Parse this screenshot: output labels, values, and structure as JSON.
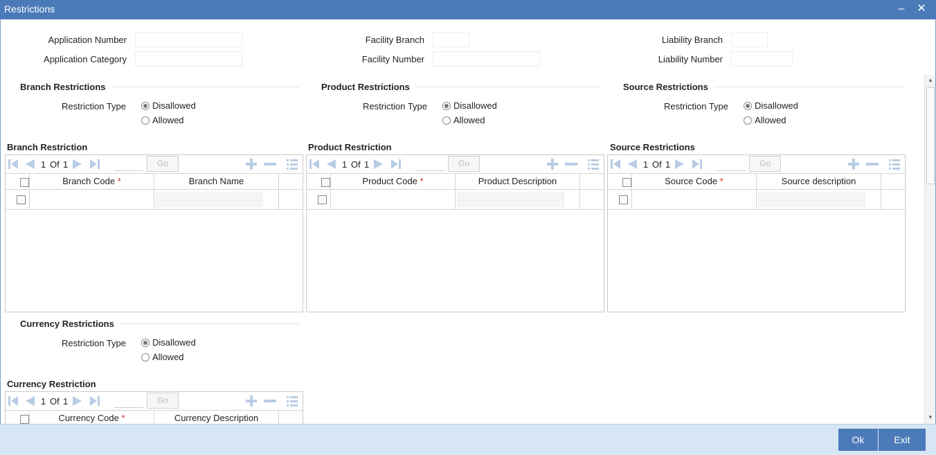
{
  "window": {
    "title": "Restrictions",
    "minimize": "‒",
    "close": "✕"
  },
  "header_fields": {
    "application_number": {
      "label": "Application Number",
      "value": ""
    },
    "application_category": {
      "label": "Application Category",
      "value": ""
    },
    "facility_branch": {
      "label": "Facility Branch",
      "value": ""
    },
    "facility_number": {
      "label": "Facility Number",
      "value": ""
    },
    "liability_branch": {
      "label": "Liability Branch",
      "value": ""
    },
    "liability_number": {
      "label": "Liability Number",
      "value": ""
    }
  },
  "restriction_label": "Restriction Type",
  "options": {
    "disallowed": "Disallowed",
    "allowed": "Allowed"
  },
  "sections": {
    "branch": {
      "title": "Branch Restrictions",
      "selected": "Disallowed"
    },
    "product": {
      "title": "Product Restrictions",
      "selected": "Disallowed"
    },
    "source": {
      "title": "Source Restrictions",
      "selected": "Disallowed"
    },
    "currency": {
      "title": "Currency Restrictions",
      "selected": "Disallowed"
    }
  },
  "pager": {
    "current": "1",
    "of": "Of",
    "total": "1",
    "go": "Go"
  },
  "required_mark": "*",
  "grids": {
    "branch": {
      "title": "Branch Restriction",
      "col1": "Branch Code",
      "col2": "Branch Name"
    },
    "product": {
      "title": "Product Restriction",
      "col1": "Product Code",
      "col2": "Product Description"
    },
    "source": {
      "title": "Source Restrictions",
      "col1": "Source Code",
      "col2": "Source description"
    },
    "currency": {
      "title": "Currency Restriction",
      "col1": "Currency Code",
      "col2": "Currency Description"
    }
  },
  "footer": {
    "ok": "Ok",
    "exit": "Exit"
  },
  "colors": {
    "titlebar": "#4a7ab8",
    "footer": "#d7e6f4",
    "button": "#4a7ab8",
    "required": "#d62b2b",
    "nav_icon": "#b9cde4"
  }
}
